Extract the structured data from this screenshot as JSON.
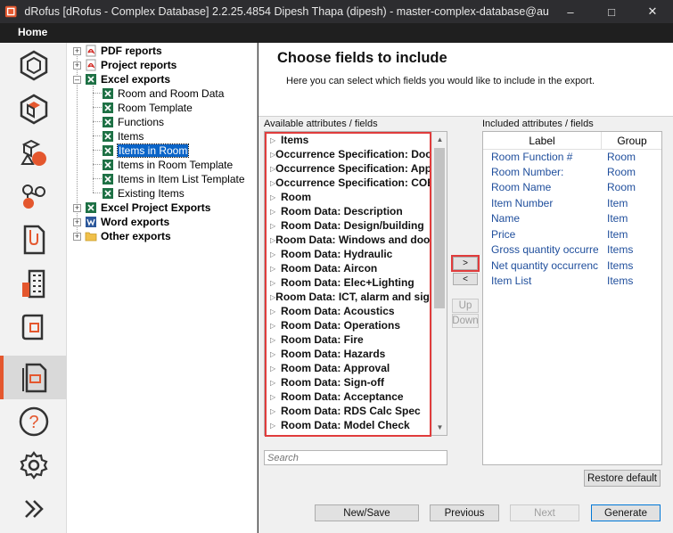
{
  "window": {
    "title": "dRofus [dRofus - Complex Database] 2.2.25.4854   Dipesh Thapa (dipesh) - master-complex-database@au.drofus.com"
  },
  "menu": {
    "home_label": "Home"
  },
  "rail": {
    "items": [
      "cube-icon",
      "cube-orange-icon",
      "shapes-icon",
      "network-icon",
      "document-icon",
      "building-icon",
      "book-icon",
      "report-icon",
      "help-icon",
      "gear-icon",
      "expand-icon"
    ],
    "accent": "#e4572e"
  },
  "tree": {
    "nodes": [
      {
        "label": "PDF reports",
        "bold": true
      },
      {
        "label": "Project reports",
        "bold": true
      },
      {
        "label": "Excel exports",
        "bold": true
      },
      {
        "label": "Room and Room Data",
        "bold": false
      },
      {
        "label": "Room Template",
        "bold": false
      },
      {
        "label": "Functions",
        "bold": false
      },
      {
        "label": "Items",
        "bold": false
      },
      {
        "label": "Items in Room",
        "bold": false
      },
      {
        "label": "Items in Room Template",
        "bold": false
      },
      {
        "label": "Items in Item List Template",
        "bold": false
      },
      {
        "label": "Existing Items",
        "bold": false
      },
      {
        "label": "Excel Project Exports",
        "bold": true
      },
      {
        "label": "Word exports",
        "bold": true
      },
      {
        "label": "Other exports",
        "bold": true
      }
    ]
  },
  "main": {
    "title": "Choose fields to include",
    "subtitle": "Here you can select which fields you would like to include in the export.",
    "available_label": "Available attributes / fields",
    "included_label": "Included attributes / fields",
    "available": [
      "Items",
      "Occurrence Specification: Doors",
      "Occurrence Specification: Appliances",
      "Occurrence Specification: COBie",
      "Room",
      "Room Data: Description",
      "Room Data: Design/building",
      "Room Data: Windows and doors",
      "Room Data: Hydraulic",
      "Room Data: Aircon",
      "Room Data: Elec+Lighting",
      "Room Data: ICT, alarm and signal",
      "Room Data: Acoustics",
      "Room Data: Operations",
      "Room Data: Fire",
      "Room Data: Hazards",
      "Room Data: Approval",
      "Room Data: Sign-off",
      "Room Data: Acceptance",
      "Room Data: RDS Calc Spec",
      "Room Data: Model Check"
    ],
    "search_placeholder": "Search",
    "move_right": ">",
    "move_left": "<",
    "up": "Up",
    "down": "Down",
    "included_headers": {
      "label": "Label",
      "group": "Group"
    },
    "included": [
      {
        "label": "Room Function #",
        "group": "Room"
      },
      {
        "label": "Room Number:",
        "group": "Room"
      },
      {
        "label": "Room Name",
        "group": "Room"
      },
      {
        "label": "Item Number",
        "group": "Item"
      },
      {
        "label": "Name",
        "group": "Item"
      },
      {
        "label": "Price",
        "group": "Item"
      },
      {
        "label": "Gross quantity occurrences",
        "group": "Items"
      },
      {
        "label": "Net quantity occurrences",
        "group": "Items"
      },
      {
        "label": "Item List",
        "group": "Items"
      }
    ],
    "restore_default": "Restore default",
    "buttons": {
      "new_save": "New/Save",
      "previous": "Previous",
      "next": "Next",
      "generate": "Generate"
    }
  },
  "colors": {
    "highlight": "#e03c3c",
    "selection": "#0a64c8",
    "link_text": "#1f4e9c"
  }
}
